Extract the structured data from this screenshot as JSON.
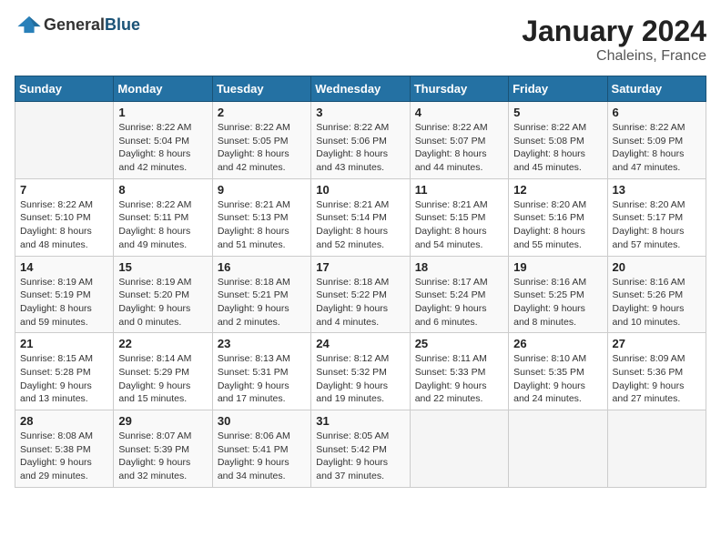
{
  "header": {
    "logo_general": "General",
    "logo_blue": "Blue",
    "month": "January 2024",
    "location": "Chaleins, France"
  },
  "weekdays": [
    "Sunday",
    "Monday",
    "Tuesday",
    "Wednesday",
    "Thursday",
    "Friday",
    "Saturday"
  ],
  "weeks": [
    [
      {
        "day": "",
        "info": ""
      },
      {
        "day": "1",
        "info": "Sunrise: 8:22 AM\nSunset: 5:04 PM\nDaylight: 8 hours\nand 42 minutes."
      },
      {
        "day": "2",
        "info": "Sunrise: 8:22 AM\nSunset: 5:05 PM\nDaylight: 8 hours\nand 42 minutes."
      },
      {
        "day": "3",
        "info": "Sunrise: 8:22 AM\nSunset: 5:06 PM\nDaylight: 8 hours\nand 43 minutes."
      },
      {
        "day": "4",
        "info": "Sunrise: 8:22 AM\nSunset: 5:07 PM\nDaylight: 8 hours\nand 44 minutes."
      },
      {
        "day": "5",
        "info": "Sunrise: 8:22 AM\nSunset: 5:08 PM\nDaylight: 8 hours\nand 45 minutes."
      },
      {
        "day": "6",
        "info": "Sunrise: 8:22 AM\nSunset: 5:09 PM\nDaylight: 8 hours\nand 47 minutes."
      }
    ],
    [
      {
        "day": "7",
        "info": "Sunrise: 8:22 AM\nSunset: 5:10 PM\nDaylight: 8 hours\nand 48 minutes."
      },
      {
        "day": "8",
        "info": "Sunrise: 8:22 AM\nSunset: 5:11 PM\nDaylight: 8 hours\nand 49 minutes."
      },
      {
        "day": "9",
        "info": "Sunrise: 8:21 AM\nSunset: 5:13 PM\nDaylight: 8 hours\nand 51 minutes."
      },
      {
        "day": "10",
        "info": "Sunrise: 8:21 AM\nSunset: 5:14 PM\nDaylight: 8 hours\nand 52 minutes."
      },
      {
        "day": "11",
        "info": "Sunrise: 8:21 AM\nSunset: 5:15 PM\nDaylight: 8 hours\nand 54 minutes."
      },
      {
        "day": "12",
        "info": "Sunrise: 8:20 AM\nSunset: 5:16 PM\nDaylight: 8 hours\nand 55 minutes."
      },
      {
        "day": "13",
        "info": "Sunrise: 8:20 AM\nSunset: 5:17 PM\nDaylight: 8 hours\nand 57 minutes."
      }
    ],
    [
      {
        "day": "14",
        "info": "Sunrise: 8:19 AM\nSunset: 5:19 PM\nDaylight: 8 hours\nand 59 minutes."
      },
      {
        "day": "15",
        "info": "Sunrise: 8:19 AM\nSunset: 5:20 PM\nDaylight: 9 hours\nand 0 minutes."
      },
      {
        "day": "16",
        "info": "Sunrise: 8:18 AM\nSunset: 5:21 PM\nDaylight: 9 hours\nand 2 minutes."
      },
      {
        "day": "17",
        "info": "Sunrise: 8:18 AM\nSunset: 5:22 PM\nDaylight: 9 hours\nand 4 minutes."
      },
      {
        "day": "18",
        "info": "Sunrise: 8:17 AM\nSunset: 5:24 PM\nDaylight: 9 hours\nand 6 minutes."
      },
      {
        "day": "19",
        "info": "Sunrise: 8:16 AM\nSunset: 5:25 PM\nDaylight: 9 hours\nand 8 minutes."
      },
      {
        "day": "20",
        "info": "Sunrise: 8:16 AM\nSunset: 5:26 PM\nDaylight: 9 hours\nand 10 minutes."
      }
    ],
    [
      {
        "day": "21",
        "info": "Sunrise: 8:15 AM\nSunset: 5:28 PM\nDaylight: 9 hours\nand 13 minutes."
      },
      {
        "day": "22",
        "info": "Sunrise: 8:14 AM\nSunset: 5:29 PM\nDaylight: 9 hours\nand 15 minutes."
      },
      {
        "day": "23",
        "info": "Sunrise: 8:13 AM\nSunset: 5:31 PM\nDaylight: 9 hours\nand 17 minutes."
      },
      {
        "day": "24",
        "info": "Sunrise: 8:12 AM\nSunset: 5:32 PM\nDaylight: 9 hours\nand 19 minutes."
      },
      {
        "day": "25",
        "info": "Sunrise: 8:11 AM\nSunset: 5:33 PM\nDaylight: 9 hours\nand 22 minutes."
      },
      {
        "day": "26",
        "info": "Sunrise: 8:10 AM\nSunset: 5:35 PM\nDaylight: 9 hours\nand 24 minutes."
      },
      {
        "day": "27",
        "info": "Sunrise: 8:09 AM\nSunset: 5:36 PM\nDaylight: 9 hours\nand 27 minutes."
      }
    ],
    [
      {
        "day": "28",
        "info": "Sunrise: 8:08 AM\nSunset: 5:38 PM\nDaylight: 9 hours\nand 29 minutes."
      },
      {
        "day": "29",
        "info": "Sunrise: 8:07 AM\nSunset: 5:39 PM\nDaylight: 9 hours\nand 32 minutes."
      },
      {
        "day": "30",
        "info": "Sunrise: 8:06 AM\nSunset: 5:41 PM\nDaylight: 9 hours\nand 34 minutes."
      },
      {
        "day": "31",
        "info": "Sunrise: 8:05 AM\nSunset: 5:42 PM\nDaylight: 9 hours\nand 37 minutes."
      },
      {
        "day": "",
        "info": ""
      },
      {
        "day": "",
        "info": ""
      },
      {
        "day": "",
        "info": ""
      }
    ]
  ]
}
